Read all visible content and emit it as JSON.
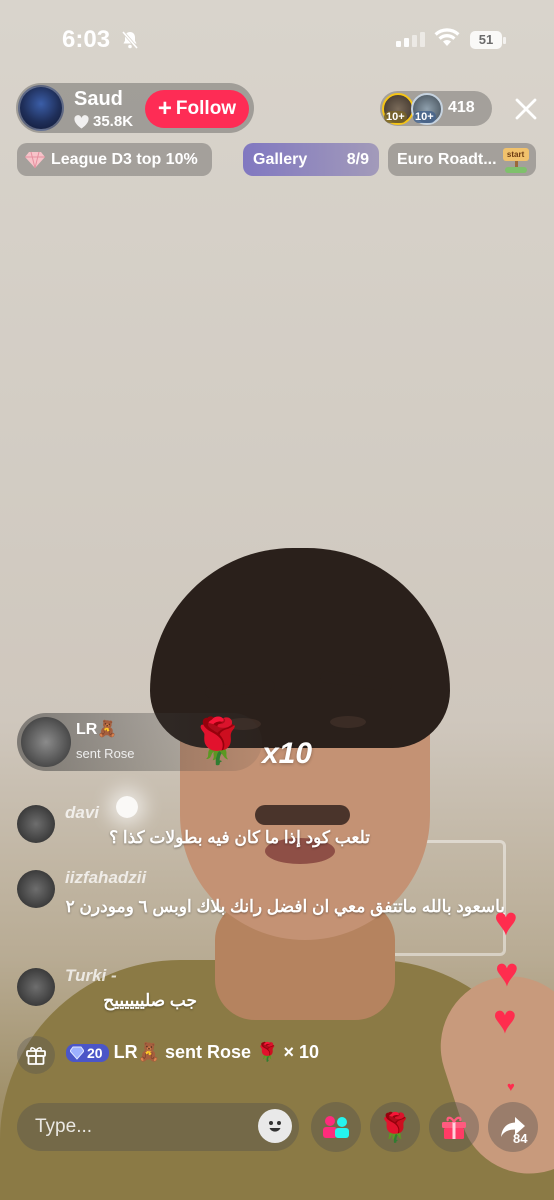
{
  "status_bar": {
    "time": "6:03",
    "battery": "51"
  },
  "host": {
    "name": "Saud",
    "likes": "35.8K",
    "follow_label": "Follow"
  },
  "viewers": {
    "badge_1": "10+",
    "badge_2": "10+",
    "count": "418"
  },
  "tags": {
    "league": "League D3 top 10%",
    "gallery_label": "Gallery",
    "gallery_count": "8/9",
    "euro": "Euro Roadt...",
    "start_badge": "start"
  },
  "gift_banner": {
    "user": "LR🧸",
    "action": "sent Rose",
    "rose": "🌹",
    "count": "x10"
  },
  "comments": [
    {
      "user": "davi",
      "text": "تلعب كود إذا ما كان فيه بطولات كذا ؟"
    },
    {
      "user": "iizfahadzii",
      "text": "ياسعود بالله ماتتفق معي ان افضل رانك بلاك اوبس ٦ ومودرن ٢"
    },
    {
      "user": "Turki -",
      "text": "جب صلييييييح"
    }
  ],
  "activity": {
    "level": "20",
    "user": "LR🧸",
    "action": "sent Rose",
    "rose": "🌹",
    "count": "× 10"
  },
  "bottom_bar": {
    "input_placeholder": "Type...",
    "share_count": "84"
  },
  "colors": {
    "follow": "#fe2c55",
    "heart": "#ff2d4e",
    "gallery": "#6a5fbe",
    "level_badge": "#4b56c8"
  }
}
